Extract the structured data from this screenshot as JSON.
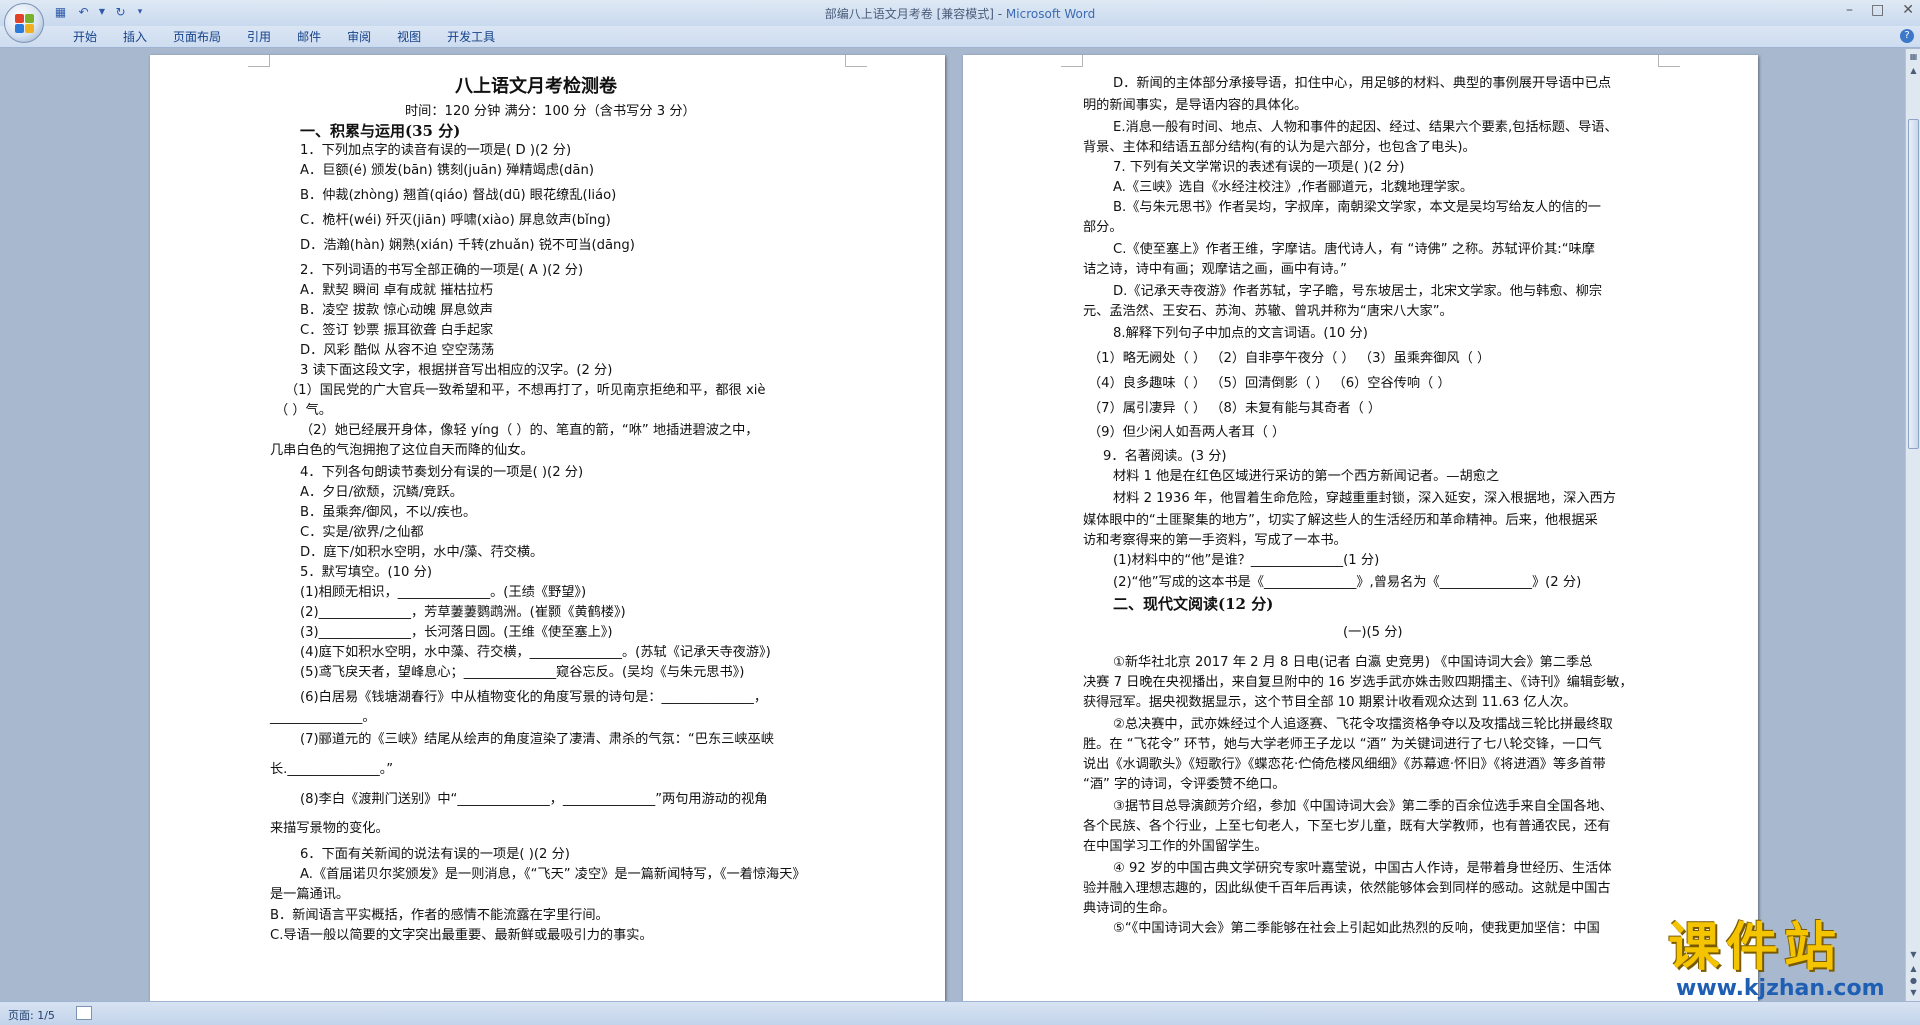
{
  "window": {
    "title": "部编八上语文月考卷 [兼容模式] - ",
    "app": "Microsoft Word"
  },
  "ribbon": {
    "tabs": [
      "开始",
      "插入",
      "页面布局",
      "引用",
      "邮件",
      "审阅",
      "视图",
      "开发工具"
    ]
  },
  "status": {
    "page": "页面: 1/5"
  },
  "watermark": {
    "main": "课件站",
    "url": "www.kjzhan.com"
  },
  "left_page": {
    "lines": [
      "八上语文月考检测卷",
      "时间：120 分钟      满分：100 分（含书写分 3 分）",
      "一、积累与运用(35 分)",
      "1．下列加点字的读音有误的一项是( D    )(2 分)",
      "A．巨额(é)            颁发(bān)          镌刻(juān)         殚精竭虑(dān)",
      "B．仲裁(zhòng)       翘首(qiáo)         督战(dū)             眼花缭乱(liáo)",
      "C．桅杆(wéi)          歼灭(jiān)          呼啸(xiào)         屏息敛声(bǐng)",
      "D．浩瀚(hàn)          娴熟(xián)          千转(zhuǎn)        锐不可当(dāng)",
      "2．下列词语的书写全部正确的一项是( A    )(2 分)",
      "A．默契       瞬间       卓有成就       摧枯拉朽",
      "B．凌空       拔款       惊心动魄       屏息敛声",
      "C．签订       钞票       振耳欲聋       白手起家",
      "D．风彩       酷似       从容不迫       空空荡荡",
      "3 读下面这段文字，根据拼音写出相应的汉字。(2 分)",
      "（1）国民党的广大官兵一致希望和平，不想再打了，听见南京拒绝和平，都很  xiè",
      "（        ）气。",
      "（2）她已经展开身体，像轻  yíng（          ）的、笔直的箭，“咻” 地插进碧波之中，",
      "几串白色的气泡拥抱了这位自天而降的仙女。",
      "4．下列各句朗读节奏划分有误的一项是(          )(2 分)",
      "A．夕日/欲颓，沉鳞/竞跃。",
      "B．虽乘奔/御风，不以/疾也。",
      "C．实是/欲界/之仙都",
      "D．庭下/如积水空明，水中/藻、荇交横。",
      "5．默写填空。(10 分)",
      "(1)相顾无相识，______________。(王绩《野望》)",
      "(2)______________，芳草萋萋鹦鹉洲。(崔颢《黄鹤楼》)",
      "(3)______________，长河落日圆。(王维《使至塞上》)",
      "(4)庭下如积水空明，水中藻、荇交横，______________。(苏轼《记承天寺夜游》)",
      "(5)鸢飞戾天者，望峰息心；______________窥谷忘反。(吴均《与朱元思书》)",
      "(6)白居易《钱塘湖春行》中从植物变化的角度写景的诗句是：______________，",
      "______________。",
      "(7)郦道元的《三峡》结尾从绘声的角度渲染了凄清、肃杀的气氛：“巴东三峡巫峡",
      "长.______________。”",
      "(8)李白《渡荆门送别》中“______________，______________”两句用游动的视角",
      "来描写景物的变化。",
      "6．下面有关新闻的说法有误的一项是(     )(2 分)",
      "A.《首届诺贝尔奖颁发》是一则消息，《“飞天” 凌空》是一篇新闻特写，《一着惊海天》",
      "是一篇通讯。",
      "B．新闻语言平实概括，作者的感情不能流露在字里行间。",
      "C.导语一般以简要的文字突出最重要、最新鲜或最吸引力的事实。"
    ]
  },
  "right_page": {
    "lines": [
      "D．新闻的主体部分承接导语，扣住中心，用足够的材料、典型的事例展开导语中已点",
      "明的新闻事实，是导语内容的具体化。",
      "E.消息一般有时间、地点、人物和事件的起因、经过、结果六个要素,包括标题、导语、",
      "背景、主体和结语五部分结构(有的认为是六部分，也包含了电头)。",
      "7. 下列有关文学常识的表述有误的一项是(          )(2 分)",
      "A.《三峡》选自《水经注校注》,作者郦道元，北魏地理学家。",
      "B.《与朱元思书》作者吴均，字叔庠，南朝梁文学家，本文是吴均写给友人的信的一",
      "部分。",
      "C.《使至塞上》作者王维，字摩诘。唐代诗人，有 “诗佛” 之称。苏轼评价其:“味摩",
      "诘之诗，诗中有画；观摩诘之画，画中有诗。”",
      "D.《记承天寺夜游》作者苏轼，字子瞻，号东坡居士，北宋文学家。他与韩愈、柳宗",
      "元、孟浩然、王安石、苏洵、苏辙、曾巩并称为“唐宋八大家”。",
      "8.解释下列句子中加点的文言词语。(10 分)",
      "（1）略无阙处（      ）  （2）自非亭午夜分（      ）  （3）虽乘奔御风（      ）",
      "（4）良多趣味（      ）  （5）回清倒影（      ）  （6）空谷传响（      ）",
      "（7）属引凄异（      ）  （8）未复有能与其奇者（      ）",
      "（9）但少闲人如吾两人者耳（      ）",
      "9．名著阅读。(3 分)",
      "材料 1    他是在红色区域进行采访的第一个西方新闻记者。—胡愈之",
      "材料 2    1936 年，他冒着生命危险，穿越重重封锁，深入延安，深入根据地，深入西方",
      "媒体眼中的“土匪聚集的地方”，切实了解这些人的生活经历和革命精神。后来，他根据采",
      "访和考察得来的第一手资料，写成了一本书。",
      "(1)材料中的“他”是谁？______________(1 分)",
      "(2)“他”写成的这本书是《______________》,曾易名为《______________》(2 分)",
      "二、现代文阅读(12 分)",
      "(一)(5 分)",
      "①新华社北京 2017 年 2 月 8 日电(记者  白瀛  史竞男)  《中国诗词大会》第二季总",
      "决赛 7 日晚在央视播出，来自复旦附中的 16 岁选手武亦姝击败四期擂主、《诗刊》编辑彭敏，",
      "获得冠军。据央视数据显示，这个节目全部 10 期累计收看观众达到 11.63 亿人次。",
      "②总决赛中，武亦姝经过个人追逐赛、飞花令攻擂资格争夺以及攻擂战三轮比拼最终取",
      "胜。在 “飞花令” 环节，她与大学老师王子龙以 “酒” 为关键词进行了七八轮交锋，一口气",
      "说出《水调歌头》《短歌行》《蝶恋花·伫倚危楼风细细》《苏幕遮·怀旧》《将进酒》等多首带",
      "“酒” 字的诗词，令评委赞不绝口。",
      "③据节目总导演颜芳介绍，参加《中国诗词大会》第二季的百余位选手来自全国各地、",
      "各个民族、各个行业，上至七旬老人，下至七岁儿童，既有大学教师，也有普通农民，还有",
      "在中国学习工作的外国留学生。",
      "④ 92 岁的中国古典文学研究专家叶嘉莹说，中国古人作诗，是带着身世经历、生活体",
      "验并融入理想志趣的，因此纵使千百年后再读，依然能够体会到同样的感动。这就是中国古",
      "典诗词的生命。",
      "⑤“《中国诗词大会》第二季能够在社会上引起如此热烈的反响，使我更加坚信：中国"
    ]
  }
}
